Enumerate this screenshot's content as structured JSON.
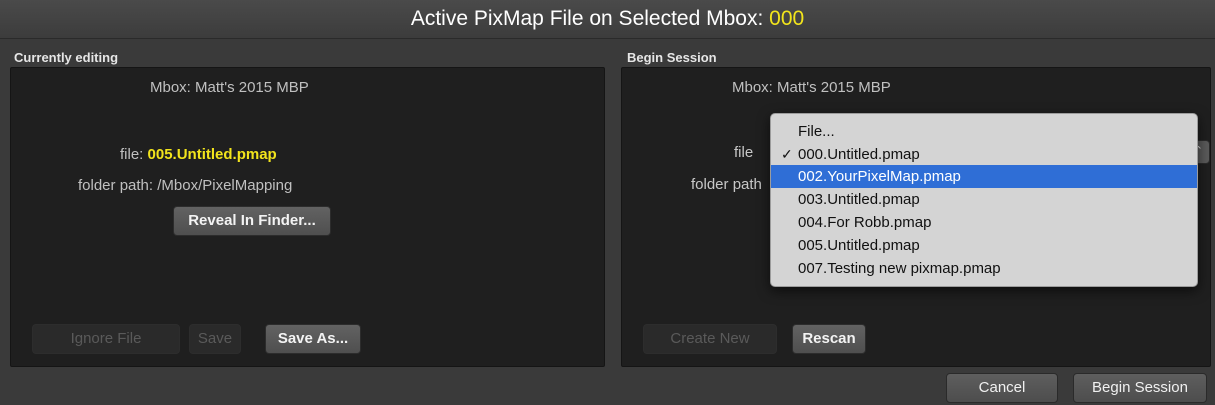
{
  "window": {
    "title_prefix": "Active PixMap File on Selected Mbox: ",
    "title_value": "000",
    "accent_color": "#f2e41c",
    "selection_color": "#2f6ed6"
  },
  "left_panel": {
    "section_label": "Currently editing",
    "mbox_label": "Mbox:",
    "mbox_value": "Matt's 2015 MBP",
    "file_label": "file:",
    "file_value": "005.Untitled.pmap",
    "folder_label": "folder path:",
    "folder_value": "/Mbox/PixelMapping",
    "reveal_button": "Reveal In Finder...",
    "ignore_button": "Ignore File",
    "save_button": "Save",
    "save_as_button": "Save As..."
  },
  "right_panel": {
    "section_label": "Begin Session",
    "mbox_label": "Mbox:",
    "mbox_value": "Matt's 2015 MBP",
    "file_label": "file",
    "folder_label": "folder path",
    "create_button": "Create New",
    "rescan_button": "Rescan"
  },
  "dropdown": {
    "checkmark": "✓",
    "options": [
      {
        "label": "File...",
        "checked": false,
        "highlighted": false
      },
      {
        "label": "000.Untitled.pmap",
        "checked": true,
        "highlighted": false
      },
      {
        "label": "002.YourPixelMap.pmap",
        "checked": false,
        "highlighted": true
      },
      {
        "label": "003.Untitled.pmap",
        "checked": false,
        "highlighted": false
      },
      {
        "label": "004.For Robb.pmap",
        "checked": false,
        "highlighted": false
      },
      {
        "label": "005.Untitled.pmap",
        "checked": false,
        "highlighted": false
      },
      {
        "label": "007.Testing new pixmap.pmap",
        "checked": false,
        "highlighted": false
      }
    ]
  },
  "footer": {
    "cancel_button": "Cancel",
    "begin_button": "Begin Session"
  }
}
